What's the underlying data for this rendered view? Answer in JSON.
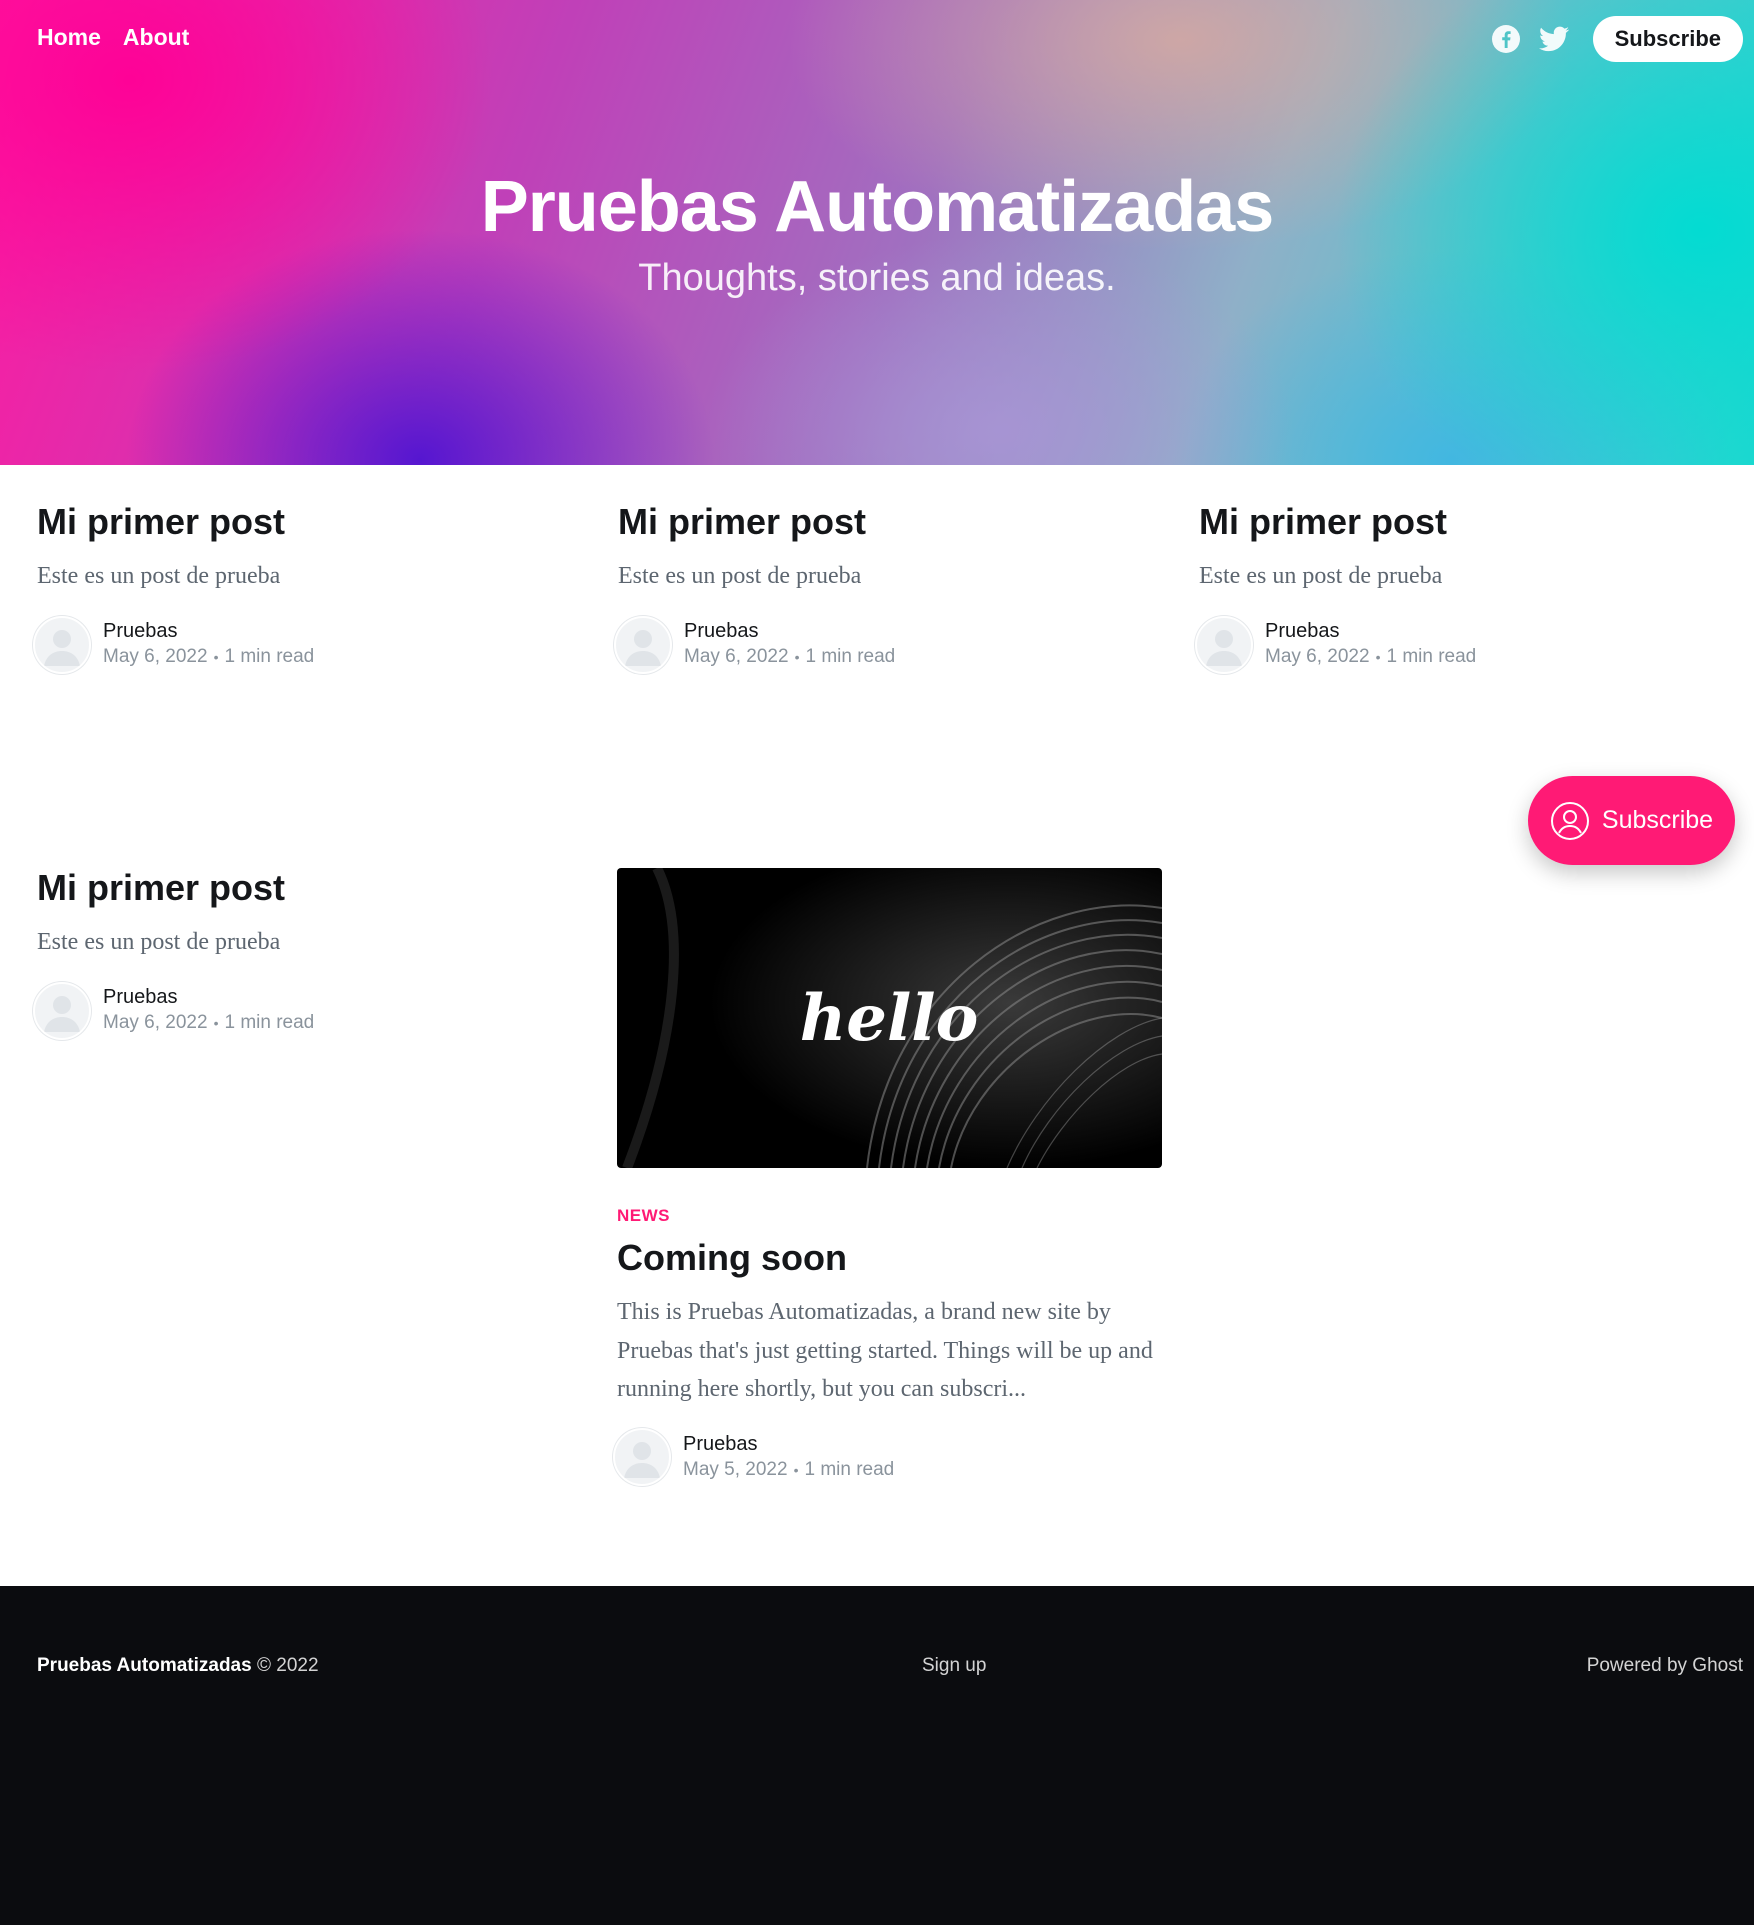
{
  "header": {
    "nav": [
      {
        "label": "Home"
      },
      {
        "label": "About"
      }
    ],
    "social_icons": [
      "facebook-icon",
      "twitter-icon"
    ],
    "subscribe_label": "Subscribe"
  },
  "hero": {
    "title": "Pruebas Automatizadas",
    "description": "Thoughts, stories and ideas."
  },
  "posts": [
    {
      "title": "Mi primer post",
      "excerpt": "Este es un post de prueba",
      "author": "Pruebas",
      "date": "May 6, 2022",
      "reading_time": "1 min read"
    },
    {
      "title": "Mi primer post",
      "excerpt": "Este es un post de prueba",
      "author": "Pruebas",
      "date": "May 6, 2022",
      "reading_time": "1 min read"
    },
    {
      "title": "Mi primer post",
      "excerpt": "Este es un post de prueba",
      "author": "Pruebas",
      "date": "May 6, 2022",
      "reading_time": "1 min read"
    },
    {
      "title": "Mi primer post",
      "excerpt": "Este es un post de prueba",
      "author": "Pruebas",
      "date": "May 6, 2022",
      "reading_time": "1 min read"
    },
    {
      "image_text": "hello",
      "tag": "NEWS",
      "title": "Coming soon",
      "excerpt": "This is Pruebas Automatizadas, a brand new site by Pruebas that's just getting started. Things will be up and running here shortly, but you can subscri...",
      "author": "Pruebas",
      "date": "May 5, 2022",
      "reading_time": "1 min read"
    }
  ],
  "floating_subscribe": {
    "label": "Subscribe"
  },
  "footer": {
    "brand": "Pruebas Automatizadas",
    "copyright": "© 2022",
    "signup_label": "Sign up",
    "powered_by": "Powered by Ghost"
  },
  "colors": {
    "accent": "#ff1a75",
    "footer_bg": "#0b0c0f",
    "text_dark": "#15171a",
    "text_muted": "#8a939c"
  }
}
